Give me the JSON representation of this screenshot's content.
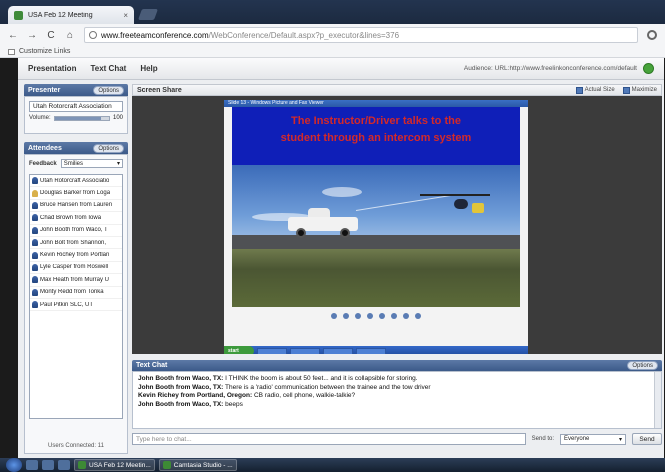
{
  "browser": {
    "tab_title": "USA Feb 12 Meeting",
    "tab_close": "×",
    "url_domain": "www.freeteamconference.com",
    "url_path": "/WebConference/Default.aspx?p_executor&lines=376",
    "bookmark": "Customize Links",
    "nav_back": "←",
    "nav_forward": "→",
    "nav_reload": "C",
    "nav_home": "⌂"
  },
  "menubar": {
    "items": [
      "Presentation",
      "Text Chat",
      "Help"
    ],
    "audience": "Audience: URL:http://www.freelinkonconference.com/default"
  },
  "presenter": {
    "title": "Presenter",
    "options": "Options",
    "name": "Utah Rotorcraft Association",
    "volume_label": "Volume:",
    "volume_value": "100",
    "volume_fraction": 0.85
  },
  "attendees": {
    "title": "Attendees",
    "options": "Options",
    "feedback_label": "Feedback",
    "feedback_value": "Smilies",
    "list": [
      "Utah Rotorcraft Associatio",
      "Douglas Barker from Loga",
      "Bruce Hansen from Lauren",
      "Chad Brown from Iowa",
      "John Booth from Waco, T",
      "John Bolt from Shannon,",
      "Kevin Richey from Portlan",
      "Lyle Casper from Roswell",
      "Max Heath from Murray U",
      "Monty Redd from Tonka",
      "Paul Pitkin SLC, UT"
    ],
    "users_connected": "Users Connected: 11"
  },
  "screen_share": {
    "title": "Screen Share",
    "actual_size": "Actual Size",
    "maximize": "Maximize",
    "remote_title": "Slide 13 - Windows Picture and Fax Viewer",
    "slide_line1": "The Instructor/Driver talks to the",
    "slide_line2": "student  through an intercom system",
    "remote_start": "start"
  },
  "chat": {
    "title": "Text Chat",
    "options": "Options",
    "messages": [
      {
        "sender": "John Booth from Waco, TX:",
        "text": "I THINK the boom is about 50 feet... and it is collapsible for storing."
      },
      {
        "sender": "John Booth from Waco, TX:",
        "text": "There is a 'radio' communication between the trainee and the tow driver"
      },
      {
        "sender": "Kevin Richey from Portland, Oregon:",
        "text": "CB radio, cell phone, walkie-talkie?"
      },
      {
        "sender": "John Booth from Waco, TX:",
        "text": "beeps"
      }
    ],
    "input_placeholder": "Type here to chat...",
    "send_to_label": "Send to:",
    "send_to_value": "Everyone",
    "send_label": "Send"
  },
  "taskbar": {
    "items": [
      "USA Feb 12 Meetin...",
      "Camtasia Studio - ..."
    ]
  }
}
